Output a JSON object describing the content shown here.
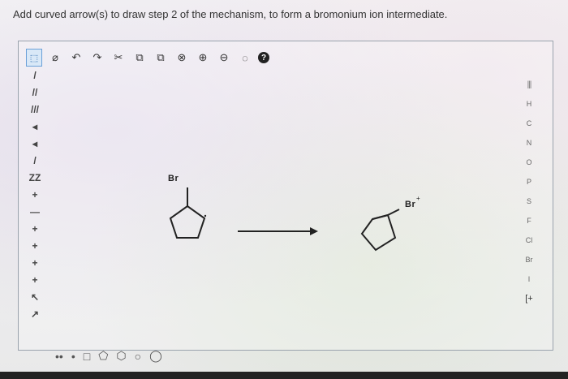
{
  "question": {
    "prompt": "Add curved arrow(s) to draw step 2 of the mechanism, to form a bromonium ion intermediate."
  },
  "toolbar": {
    "items": [
      {
        "name": "select-tool",
        "glyph": "⬚"
      },
      {
        "name": "erase-tool",
        "glyph": "⌀"
      },
      {
        "name": "undo-icon",
        "glyph": "↶"
      },
      {
        "name": "redo-icon",
        "glyph": "↷"
      },
      {
        "name": "cut-icon",
        "glyph": "✂"
      },
      {
        "name": "copy-icon",
        "glyph": "⧉"
      },
      {
        "name": "paste-icon",
        "glyph": "⧉"
      },
      {
        "name": "clean-icon",
        "glyph": "⊗"
      },
      {
        "name": "zoom-in-icon",
        "glyph": "⊕"
      },
      {
        "name": "zoom-out-icon",
        "glyph": "⊖"
      },
      {
        "name": "zoom-fit-icon",
        "glyph": "◌"
      },
      {
        "name": "help-icon",
        "glyph": "?"
      }
    ]
  },
  "left_tools": [
    "/",
    "//",
    "///",
    "◂",
    "◂",
    "/",
    "ZZ",
    "+",
    "—",
    "+",
    "+",
    "+",
    "+",
    "↖",
    "↗"
  ],
  "right_tools": [
    "H",
    "C",
    "N",
    "O",
    "P",
    "S",
    "F",
    "Cl",
    "Br",
    "I"
  ],
  "right_periodic": "|||",
  "right_more": "[+",
  "bottom_tools": [
    "••",
    "•",
    "□",
    "⬠",
    "⬡",
    "○",
    "◯"
  ],
  "molecules": {
    "reactant_br": "Br",
    "product_br": "Br",
    "product_charge": "+"
  },
  "colors": {
    "frame_border": "#9aa3ad",
    "select_active": "#6aa0d8",
    "ink": "#222222"
  }
}
